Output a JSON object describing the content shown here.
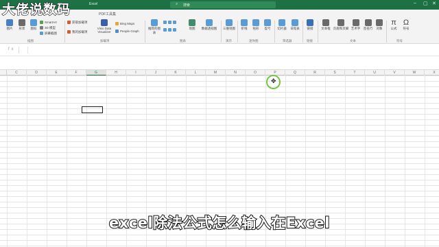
{
  "app": {
    "title": "Excel"
  },
  "search": {
    "placeholder": "搜索"
  },
  "ribbon": {
    "tabs": [
      "PDF工具集"
    ],
    "buttons": [
      {
        "label": "图片",
        "color": "#4a7fc1"
      },
      {
        "label": "形状",
        "color": "#6a6a6a"
      },
      {
        "label": "图标",
        "color": "#5b9bd5"
      },
      {
        "label": "SmartArt",
        "color": "#5aa04b"
      },
      {
        "label": "3D 模型",
        "color": "#7a7a7a"
      },
      {
        "label": "屏幕截图",
        "color": "#5b9bd5"
      },
      {
        "label": "获取加载项",
        "color": "#d65a31"
      },
      {
        "label": "我的加载项",
        "color": "#d65a31"
      },
      {
        "label": "Visio Data Visualizer",
        "color": "#3a5ea8"
      },
      {
        "label": "Bing Maps",
        "color": "#e8a33d"
      },
      {
        "label": "People Graph",
        "color": "#4f8bc9"
      },
      {
        "label": "推荐的图表",
        "color": "#5b9bd5"
      },
      {
        "label": "地图",
        "color": "#3f8c6e"
      },
      {
        "label": "数据透视图",
        "color": "#5b9bd5"
      },
      {
        "label": "三维地图",
        "color": "#5b9bd5"
      },
      {
        "label": "折线",
        "color": "#5b9bd5"
      },
      {
        "label": "柱形",
        "color": "#5b9bd5"
      },
      {
        "label": "盈亏",
        "color": "#5b9bd5"
      },
      {
        "label": "切片器",
        "color": "#5b9bd5"
      },
      {
        "label": "日程表",
        "color": "#5b9bd5"
      },
      {
        "label": "链接",
        "color": "#3a6fb5"
      },
      {
        "label": "文本框",
        "color": "#6a6a6a"
      },
      {
        "label": "页眉和页脚",
        "color": "#6a6a6a"
      },
      {
        "label": "艺术字",
        "color": "#6a6a6a"
      },
      {
        "label": "签名行",
        "color": "#6a6a6a"
      },
      {
        "label": "对象",
        "color": "#6a6a6a"
      },
      {
        "label": "公式",
        "color": "#333333"
      },
      {
        "label": "符号",
        "color": "#333333"
      }
    ],
    "groups": [
      "插图",
      "加载项",
      "图表",
      "演示",
      "迷你图",
      "筛选器",
      "链接",
      "文本",
      "符号"
    ]
  },
  "formula_bar": {
    "fx": "fx"
  },
  "columns": [
    "C",
    "D",
    "E",
    "F",
    "G",
    "H",
    "I",
    "J",
    "K",
    "L",
    "M",
    "N",
    "O",
    "P",
    "Q",
    "R",
    "S",
    "T",
    "U",
    "V",
    "W",
    "X"
  ],
  "active_column": "G",
  "overlay": {
    "watermark": "大佬说数码",
    "caption": "excel除法公式怎么输入在Excel"
  },
  "colors": {
    "excel_green": "#1e7145",
    "cursor_ring": "#76c442"
  }
}
